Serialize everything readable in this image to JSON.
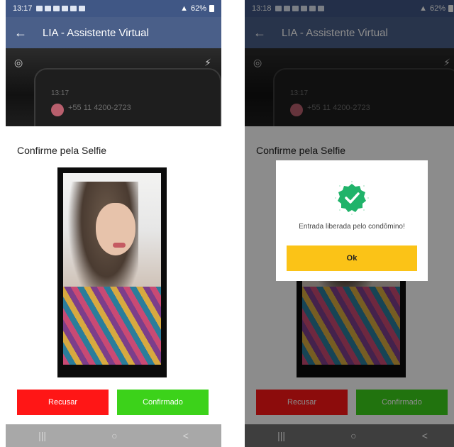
{
  "screens": [
    {
      "status_time": "13:17",
      "battery": "62%",
      "app_title": "LIA - Assistente Virtual",
      "camera_preview": {
        "ghost_time": "13:17",
        "ghost_number": "+55 11 4200-2723"
      },
      "heading": "Confirme pela Selfie",
      "buttons": {
        "reject": "Recusar",
        "confirm": "Confirmado"
      },
      "nav": {
        "recent": "|||",
        "home": "○",
        "back": "<"
      }
    },
    {
      "status_time": "13:18",
      "battery": "62%",
      "app_title": "LIA - Assistente Virtual",
      "camera_preview": {
        "ghost_time": "13:17",
        "ghost_number": "+55 11 4200-2723"
      },
      "heading": "Confirme pela Selfie",
      "buttons": {
        "reject": "Recusar",
        "confirm": "Confirmado"
      },
      "nav": {
        "recent": "|||",
        "home": "○",
        "back": "<"
      },
      "modal": {
        "message": "Entrada liberada pelo condômino!",
        "ok_label": "Ok"
      }
    }
  ],
  "colors": {
    "status_bar": "#405785",
    "app_bar": "#4a5f89",
    "reject": "#ff1616",
    "confirm": "#3cd21a",
    "ok": "#fbc317",
    "success_badge": "#20b36a"
  }
}
